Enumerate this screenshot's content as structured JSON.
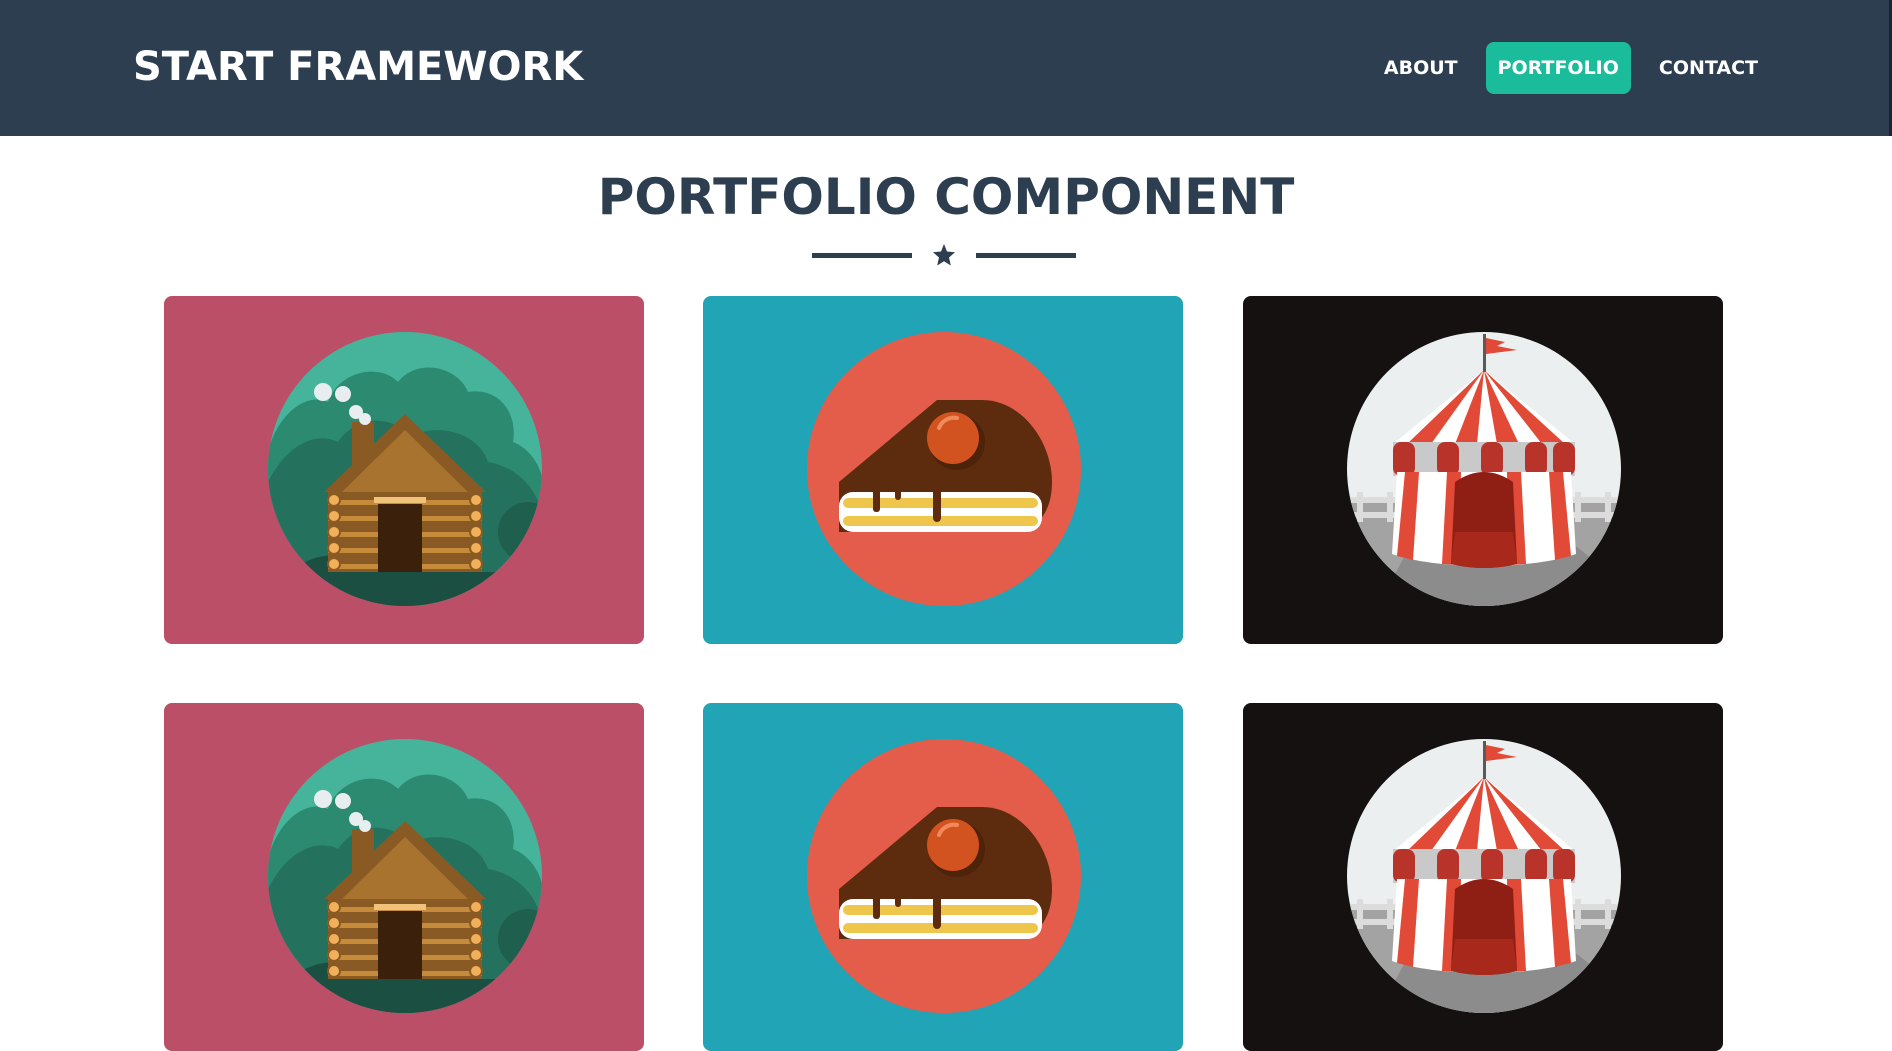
{
  "navbar": {
    "brand": "START FRAMEWORK",
    "links": [
      {
        "label": "ABOUT",
        "active": false
      },
      {
        "label": "PORTFOLIO",
        "active": true
      },
      {
        "label": "CONTACT",
        "active": false
      }
    ]
  },
  "main": {
    "title": "PORTFOLIO COMPONENT",
    "divider_icon": "star-icon"
  },
  "portfolio": {
    "items": [
      {
        "image": "cabin-icon",
        "background": "#bb4f67"
      },
      {
        "image": "cake-icon",
        "background": "#21a4b5"
      },
      {
        "image": "circus-tent-icon",
        "background": "#141110"
      },
      {
        "image": "cabin-icon",
        "background": "#bb4f67"
      },
      {
        "image": "cake-icon",
        "background": "#21a4b5"
      },
      {
        "image": "circus-tent-icon",
        "background": "#141110"
      }
    ]
  },
  "colors": {
    "navbar": "#2c3e50",
    "accent": "#1abc9c",
    "heading": "#2c3e50"
  }
}
